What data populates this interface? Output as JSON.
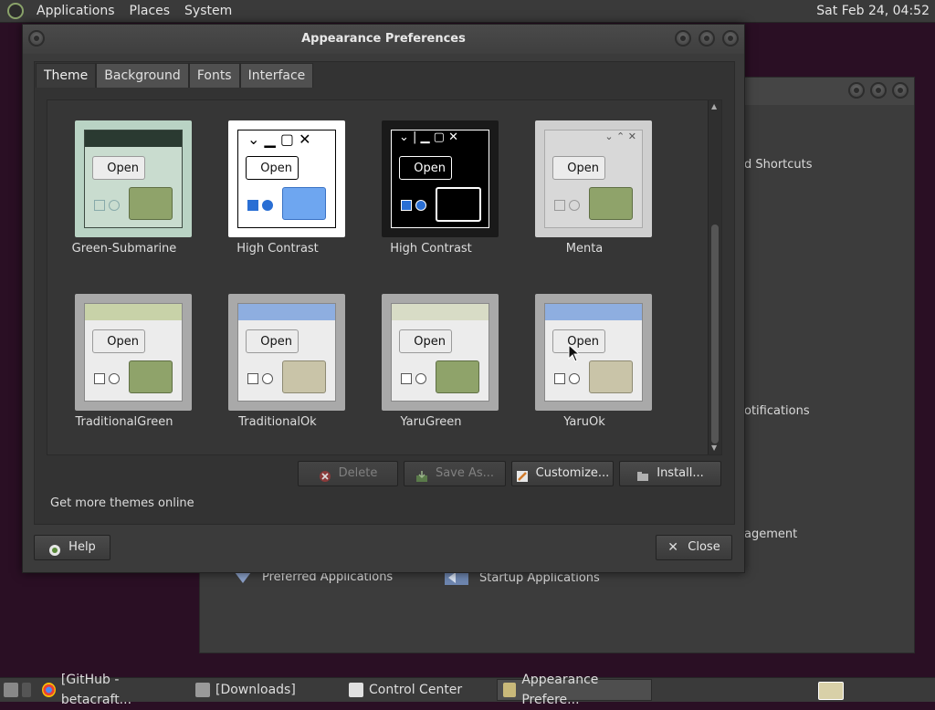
{
  "top_panel": {
    "menus": [
      "Applications",
      "Places",
      "System"
    ],
    "clock": "Sat Feb 24, 04:52"
  },
  "bg_window": {
    "labels": [
      "d Shortcuts",
      "otifications",
      "agement"
    ],
    "bottom_items": [
      "Preferred Applications",
      "Startup Applications"
    ]
  },
  "dialog": {
    "title": "Appearance Preferences",
    "tabs": [
      "Theme",
      "Background",
      "Fonts",
      "Interface"
    ],
    "active_tab": "Theme",
    "themes": [
      {
        "name": "Green-Submarine",
        "open": "Open"
      },
      {
        "name": "High Contrast",
        "open": "Open"
      },
      {
        "name": "High Contrast",
        "open": "Open"
      },
      {
        "name": "Menta",
        "open": "Open"
      },
      {
        "name": "TraditionalGreen",
        "open": "Open"
      },
      {
        "name": "TraditionalOk",
        "open": "Open"
      },
      {
        "name": "YaruGreen",
        "open": "Open"
      },
      {
        "name": "YaruOk",
        "open": "Open"
      }
    ],
    "buttons": {
      "delete": "Delete",
      "save_as": "Save As...",
      "customize": "Customize...",
      "install": "Install..."
    },
    "more_link": "Get more themes online",
    "help": "Help",
    "close": "Close"
  },
  "taskbar": {
    "items": [
      "[GitHub - betacraft...",
      "[Downloads]",
      "Control Center",
      "Appearance Prefere..."
    ]
  },
  "colors": {
    "desktop": "#2a0f24",
    "panel": "#3a3a3a",
    "window": "#3b3b3b"
  }
}
